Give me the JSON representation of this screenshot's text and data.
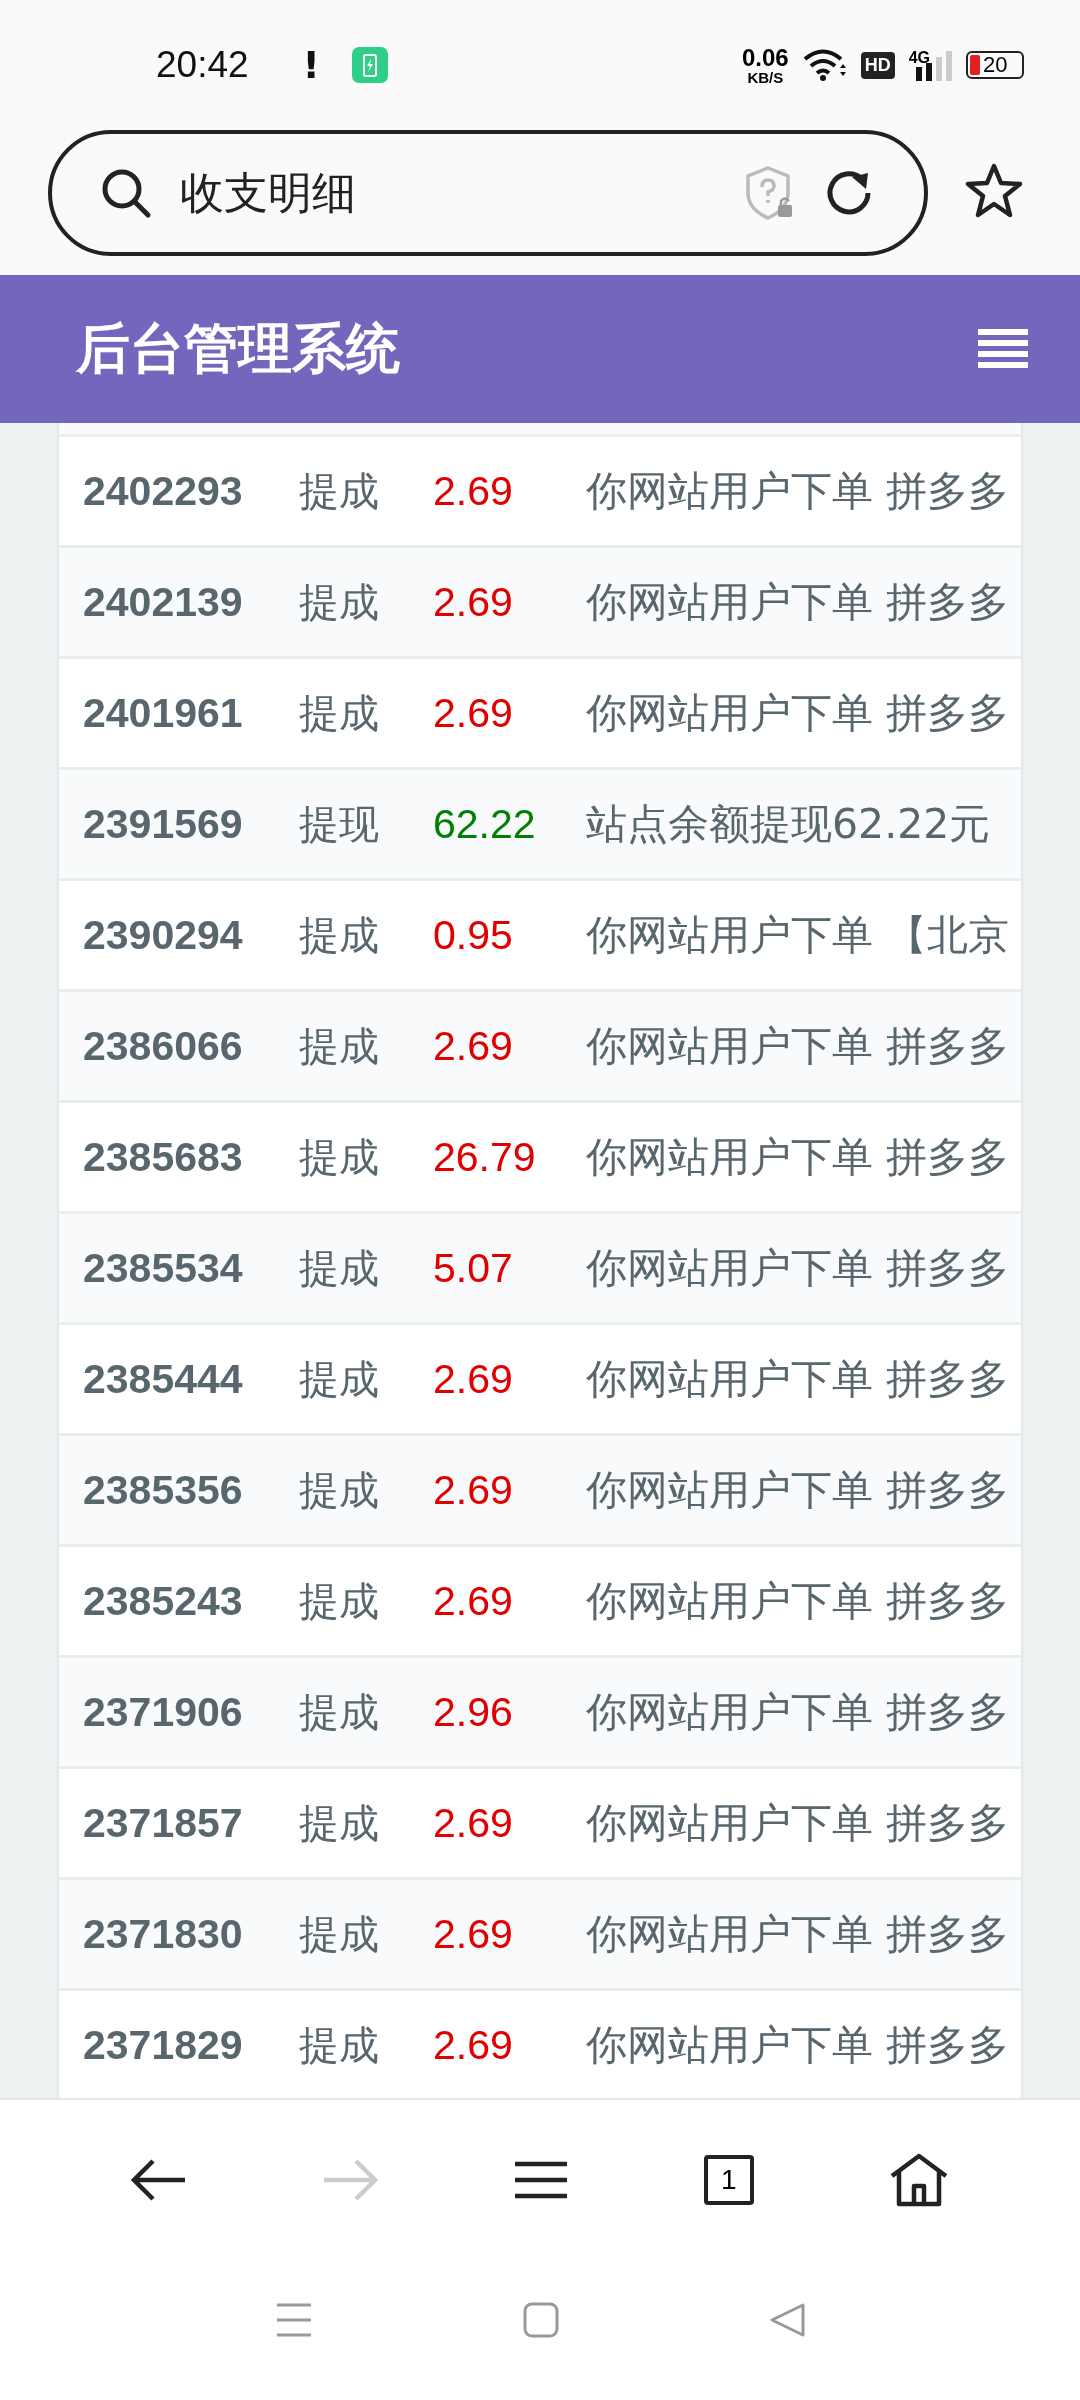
{
  "status_bar": {
    "time": "20:42",
    "alert": "!",
    "net_speed": "0.06",
    "net_unit": "KB/S",
    "hd": "HD",
    "network": "4G",
    "battery": "20"
  },
  "address_bar": {
    "value": "收支明细"
  },
  "header": {
    "title": "后台管理系统"
  },
  "rows": [
    {
      "id": "2402293",
      "type": "提成",
      "amount": "2.69",
      "color": "#e00000",
      "desc": "你网站用户下单 拼多多"
    },
    {
      "id": "2402139",
      "type": "提成",
      "amount": "2.69",
      "color": "#e00000",
      "desc": "你网站用户下单 拼多多"
    },
    {
      "id": "2401961",
      "type": "提成",
      "amount": "2.69",
      "color": "#e00000",
      "desc": "你网站用户下单 拼多多"
    },
    {
      "id": "2391569",
      "type": "提现",
      "amount": "62.22",
      "color": "#008000",
      "desc": "站点余额提现62.22元"
    },
    {
      "id": "2390294",
      "type": "提成",
      "amount": "0.95",
      "color": "#e00000",
      "desc": "你网站用户下单 【北京"
    },
    {
      "id": "2386066",
      "type": "提成",
      "amount": "2.69",
      "color": "#e00000",
      "desc": "你网站用户下单 拼多多"
    },
    {
      "id": "2385683",
      "type": "提成",
      "amount": "26.79",
      "color": "#e00000",
      "desc": "你网站用户下单 拼多多"
    },
    {
      "id": "2385534",
      "type": "提成",
      "amount": "5.07",
      "color": "#e00000",
      "desc": "你网站用户下单 拼多多"
    },
    {
      "id": "2385444",
      "type": "提成",
      "amount": "2.69",
      "color": "#e00000",
      "desc": "你网站用户下单 拼多多"
    },
    {
      "id": "2385356",
      "type": "提成",
      "amount": "2.69",
      "color": "#e00000",
      "desc": "你网站用户下单 拼多多"
    },
    {
      "id": "2385243",
      "type": "提成",
      "amount": "2.69",
      "color": "#e00000",
      "desc": "你网站用户下单 拼多多"
    },
    {
      "id": "2371906",
      "type": "提成",
      "amount": "2.96",
      "color": "#e00000",
      "desc": "你网站用户下单 拼多多"
    },
    {
      "id": "2371857",
      "type": "提成",
      "amount": "2.69",
      "color": "#e00000",
      "desc": "你网站用户下单 拼多多"
    },
    {
      "id": "2371830",
      "type": "提成",
      "amount": "2.69",
      "color": "#e00000",
      "desc": "你网站用户下单 拼多多"
    },
    {
      "id": "2371829",
      "type": "提成",
      "amount": "2.69",
      "color": "#e00000",
      "desc": "你网站用户下单 拼多多"
    }
  ],
  "bottom_nav": {
    "tab_count": "1"
  }
}
